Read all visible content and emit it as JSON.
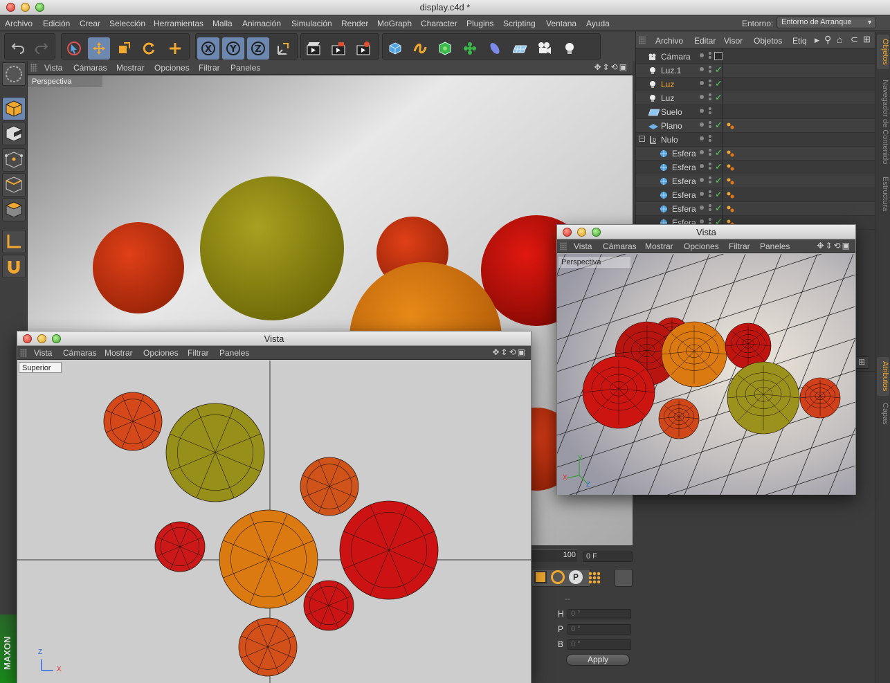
{
  "window": {
    "title": "display.c4d *"
  },
  "menubar": {
    "items": [
      "Archivo",
      "Edición",
      "Crear",
      "Selección",
      "Herramientas",
      "Malla",
      "Animación",
      "Simulación",
      "Render",
      "MoGraph",
      "Character",
      "Plugins",
      "Scripting",
      "Ventana",
      "Ayuda"
    ],
    "env_label": "Entorno:",
    "env_value": "Entorno de Arranque"
  },
  "toolbar": {
    "icons": [
      "undo-icon",
      "redo-icon",
      "live-selection-icon",
      "move-icon",
      "scale-icon",
      "rotate-icon",
      "add-icon",
      "x-axis-icon",
      "y-axis-icon",
      "z-axis-icon",
      "world-coordinates-icon",
      "render-view-icon",
      "render-picture-viewer-icon",
      "render-settings-icon",
      "cube-icon",
      "spline-icon",
      "nurbs-icon",
      "array-icon",
      "deformer-icon",
      "floor-icon",
      "camera-icon",
      "light-icon"
    ]
  },
  "left_tools": {
    "icons": [
      "model-mode-icon",
      "object-mode-icon",
      "texture-mode-icon",
      "points-mode-icon",
      "edges-mode-icon",
      "polygons-mode-icon",
      "axis-mode-icon",
      "snap-icon"
    ]
  },
  "main_viewport": {
    "menu": [
      "Vista",
      "Cámaras",
      "Mostrar",
      "Opciones",
      "Filtrar",
      "Paneles"
    ],
    "camera": "Perspectiva"
  },
  "object_manager": {
    "menu": [
      "Archivo",
      "Editar",
      "Visor",
      "Objetos",
      "Etiq"
    ],
    "objects": [
      {
        "name": "Cámara",
        "type": "camera",
        "selected": false,
        "check": false,
        "tag": "target"
      },
      {
        "name": "Luz.1",
        "type": "light",
        "selected": false,
        "check": true,
        "tag": ""
      },
      {
        "name": "Luz",
        "type": "light",
        "selected": true,
        "check": true,
        "tag": ""
      },
      {
        "name": "Luz",
        "type": "light",
        "selected": false,
        "check": true,
        "tag": ""
      },
      {
        "name": "Suelo",
        "type": "floor",
        "selected": false,
        "check": false,
        "tag": ""
      },
      {
        "name": "Plano",
        "type": "plane",
        "selected": false,
        "check": true,
        "tag": "material"
      },
      {
        "name": "Nulo",
        "type": "null",
        "selected": false,
        "check": false,
        "tag": ""
      },
      {
        "name": "Esfera",
        "type": "sphere",
        "selected": false,
        "check": true,
        "tag": "material"
      },
      {
        "name": "Esfera",
        "type": "sphere",
        "selected": false,
        "check": true,
        "tag": "material"
      },
      {
        "name": "Esfera",
        "type": "sphere",
        "selected": false,
        "check": true,
        "tag": "material"
      },
      {
        "name": "Esfera",
        "type": "sphere",
        "selected": false,
        "check": true,
        "tag": "material"
      },
      {
        "name": "Esfera",
        "type": "sphere",
        "selected": false,
        "check": true,
        "tag": "material"
      },
      {
        "name": "Esfera",
        "type": "sphere",
        "selected": false,
        "check": true,
        "tag": "material"
      }
    ]
  },
  "side_tabs": [
    "Objetos",
    "Navegador de Contenido",
    "Estructura",
    "Atributos",
    "Capas"
  ],
  "vista_top": {
    "title": "Vista",
    "menu": [
      "Vista",
      "Cámaras",
      "Mostrar",
      "Opciones",
      "Filtrar",
      "Paneles"
    ],
    "camera": "Superior",
    "axis_z": "Z",
    "axis_x": "X"
  },
  "vista_persp": {
    "title": "Vista",
    "menu": [
      "Vista",
      "Cámaras",
      "Mostrar",
      "Opciones",
      "Filtrar",
      "Paneles"
    ],
    "camera": "Perspectiva",
    "axis_y": "Y",
    "axis_x": "X",
    "axis_z": "Z"
  },
  "timeline": {
    "end_frame": "100",
    "current_frame": "0 F"
  },
  "coordinates": {
    "h_label": "H",
    "h_value": "0 °",
    "p_label": "P",
    "p_value": "0 °",
    "b_label": "B",
    "b_value": "0 °",
    "dashes": "--",
    "apply": "Apply"
  },
  "branding": "MAXON",
  "colors": {
    "accent": "#f0a830",
    "selection": "#6c88b0",
    "check": "#5ad05a"
  }
}
